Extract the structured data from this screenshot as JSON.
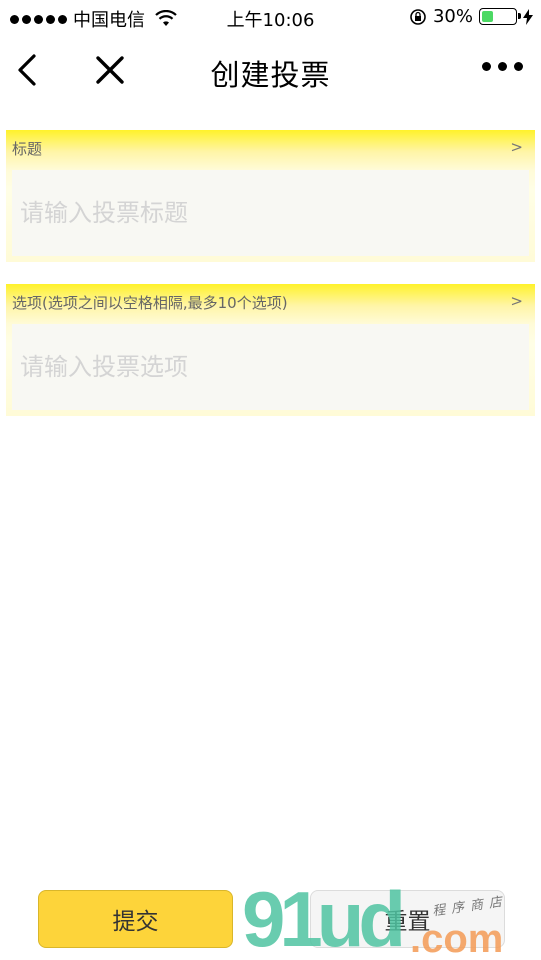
{
  "status_bar": {
    "carrier": "中国电信",
    "time": "上午10:06",
    "battery": "30%",
    "battery_level": 0.3
  },
  "nav": {
    "title": "创建投票"
  },
  "title_section": {
    "label": "标题",
    "arrow": ">",
    "placeholder": "请输入投票标题"
  },
  "options_section": {
    "label": "选项(选项之间以空格相隔,最多10个选项)",
    "arrow": ">",
    "placeholder": "请输入投票选项"
  },
  "actions": {
    "submit": "提交",
    "reset": "重置"
  },
  "watermark": {
    "brand": "91ud",
    "domain": ".com",
    "slogan": "程序商店"
  },
  "colors": {
    "accent": "#fdd43a",
    "section_top": "#fff22a",
    "watermark_green": "#4fc3a1",
    "watermark_orange": "#f39a55"
  }
}
